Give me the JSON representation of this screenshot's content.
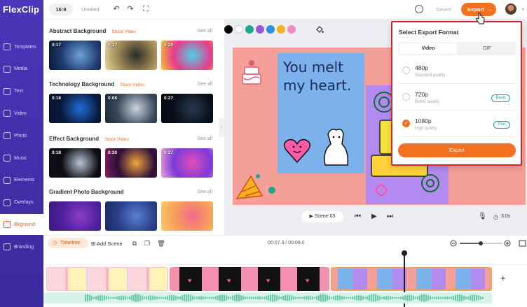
{
  "app": {
    "logo": "FlexClip",
    "ratio": "16:9",
    "doc_title": "Untitled",
    "saved": "Saved",
    "export_label": "Export",
    "export_arrow": "→"
  },
  "nav": [
    {
      "label": "Templates",
      "icon": "templates-icon"
    },
    {
      "label": "Media",
      "icon": "media-icon"
    },
    {
      "label": "Text",
      "icon": "text-icon"
    },
    {
      "label": "Video",
      "icon": "video-icon"
    },
    {
      "label": "Photo",
      "icon": "photo-icon"
    },
    {
      "label": "Music",
      "icon": "music-icon"
    },
    {
      "label": "Elements",
      "icon": "elements-icon"
    },
    {
      "label": "Overlays",
      "icon": "overlays-icon"
    },
    {
      "label": "Bkground",
      "icon": "background-icon",
      "active": true
    },
    {
      "label": "Branding",
      "icon": "branding-icon"
    }
  ],
  "panel": {
    "see_all": "See all",
    "sections": [
      {
        "title": "Abstract Background",
        "tag": "Stock Video",
        "items": [
          {
            "dur": "0:17",
            "colors": [
              "#1f3b6e",
              "#6da1d9",
              "#0c1632"
            ]
          },
          {
            "dur": "0:17",
            "colors": [
              "#a08a55",
              "#2b2b2b",
              "#e8d9a0"
            ]
          },
          {
            "dur": "0:20",
            "colors": [
              "#e83b8a",
              "#4bd1e6",
              "#f7c531"
            ]
          }
        ]
      },
      {
        "title": "Technology Background",
        "tag": "Stock Video",
        "items": [
          {
            "dur": "0:18",
            "colors": [
              "#0a1a3e",
              "#1e6fd9",
              "#06102a"
            ]
          },
          {
            "dur": "0:08",
            "colors": [
              "#3c4a5e",
              "#cbd3dd",
              "#1d2633"
            ]
          },
          {
            "dur": "0:27",
            "colors": [
              "#0b0f1a",
              "#27394f",
              "#05070c"
            ]
          }
        ]
      },
      {
        "title": "Effect Background",
        "tag": "Stock Video",
        "items": [
          {
            "dur": "0:18",
            "colors": [
              "#0c0c12",
              "#b7c4d4",
              "#101018"
            ]
          },
          {
            "dur": "0:30",
            "colors": [
              "#2a0e3a",
              "#f3a53a",
              "#8a1e5e"
            ]
          },
          {
            "dur": "0:27",
            "colors": [
              "#7a3ad9",
              "#e44fb8",
              "#f0a0d8"
            ]
          }
        ]
      },
      {
        "title": "Gradient Photo Background",
        "tag": "",
        "items": [
          {
            "dur": "",
            "colors": [
              "#4d1f9e",
              "#8b3ec9",
              "#3a1a7a"
            ]
          },
          {
            "dur": "",
            "colors": [
              "#2a3f8a",
              "#5a7fd0",
              "#1a2a5e"
            ]
          },
          {
            "dur": "",
            "colors": [
              "#f7a15a",
              "#f06a8a",
              "#fbc96a"
            ]
          }
        ]
      }
    ]
  },
  "stage": {
    "swatches": [
      "#000000",
      "#ffffff",
      "#1aa98e",
      "#9b59d9",
      "#2c8fe0",
      "#f7b21b",
      "#f08abf"
    ],
    "canvas_texts": {
      "line1": "You melt",
      "line2": "my heart."
    },
    "scene_label": "Scene 03",
    "duration": "3.0s"
  },
  "popover": {
    "title": "Select Export Format",
    "tab_video": "Video",
    "tab_gif": "GIF",
    "options": [
      {
        "res": "480p",
        "quality": "Standard quality",
        "badge": ""
      },
      {
        "res": "720p",
        "quality": "Better quality",
        "badge": "Basic"
      },
      {
        "res": "1080p",
        "quality": "High quality",
        "badge": "Plus",
        "selected": true
      }
    ],
    "export_label": "Export"
  },
  "timeline": {
    "tab_label": "Timeline",
    "add_scene": "Add Scene",
    "time": "00:07.3 / 00:09.0"
  },
  "colors": {
    "accent": "#f37021",
    "rail": "#3b2a9e",
    "popover_border": "#d0262d"
  }
}
